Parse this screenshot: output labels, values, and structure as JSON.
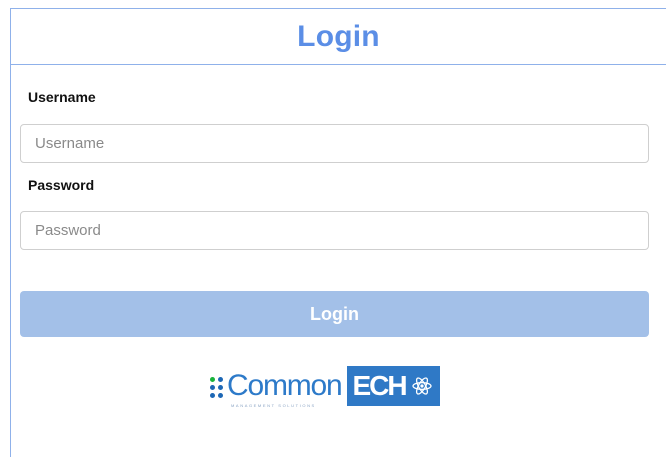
{
  "header": {
    "title": "Login"
  },
  "form": {
    "username_label": "Username",
    "username_placeholder": "Username",
    "username_value": "",
    "password_label": "Password",
    "password_placeholder": "Password",
    "password_value": "",
    "submit_label": "Login"
  },
  "logo": {
    "word": "Common",
    "box_text": "ECH",
    "tagline": "MANAGEMENT SOLUTIONS",
    "icon": "atom-icon"
  },
  "colors": {
    "accent": "#5b8ee6",
    "border": "#8fb1ea",
    "button": "#a3c0e8",
    "logo_blue": "#2f79c6",
    "logo_green": "#19b33b"
  }
}
